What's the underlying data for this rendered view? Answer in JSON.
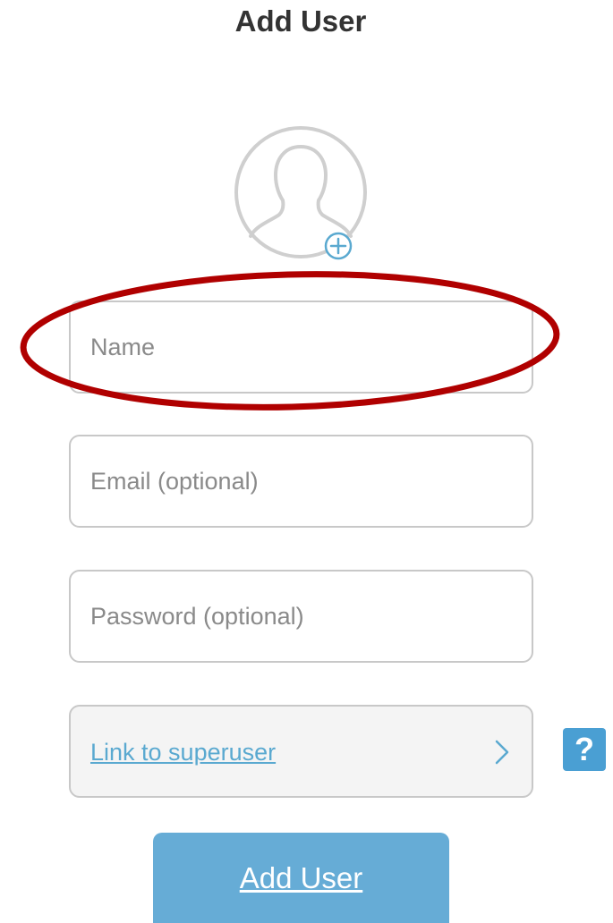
{
  "header": {
    "title": "Add User"
  },
  "avatar": {
    "icon": "user-silhouette-icon",
    "add_icon": "plus-circle-icon"
  },
  "form": {
    "name_placeholder": "Name",
    "email_placeholder": "Email (optional)",
    "password_placeholder": "Password (optional)",
    "superuser_link_label": "Link to superuser",
    "help_label": "?",
    "submit_label": "Add User"
  },
  "annotation": {
    "shape": "ellipse",
    "target": "name-field",
    "color": "#b00000"
  },
  "colors": {
    "accent": "#66acd6",
    "link": "#5aa9d0",
    "help": "#4a9fd3",
    "annotation": "#b00000"
  }
}
